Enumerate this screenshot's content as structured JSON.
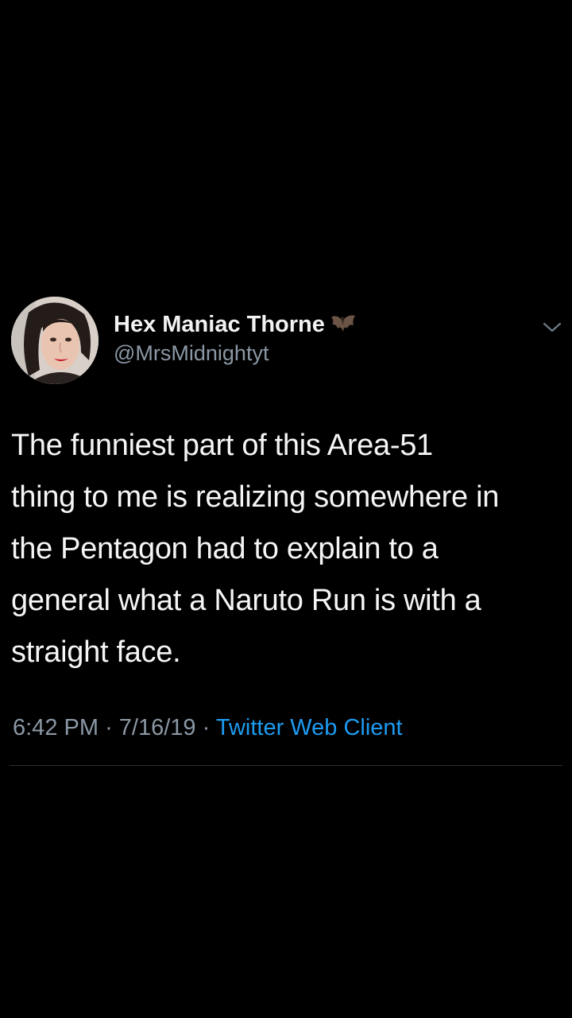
{
  "author": {
    "display_name": "Hex Maniac Thorne",
    "handle": "@MrsMidnightyt",
    "name_emoji": "bat-icon"
  },
  "tweet": {
    "text_lines": [
      "The funniest part of this Area-51",
      "thing to me is realizing somewhere in",
      "the Pentagon had to explain to a",
      "general what a Naruto Run is with a",
      "straight face."
    ]
  },
  "meta": {
    "time": "6:42 PM",
    "separator": "·",
    "date": "7/16/19",
    "client": "Twitter Web Client"
  },
  "colors": {
    "background": "#000000",
    "primary_text": "#f5f5f5",
    "secondary_text": "#8b98a5",
    "link": "#1d9bf0"
  }
}
